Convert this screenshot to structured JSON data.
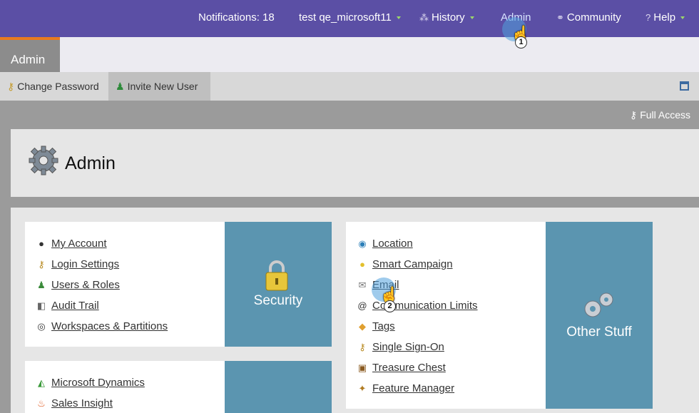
{
  "topnav": {
    "notifications": "Notifications: 18",
    "user": "test qe_microsoft11",
    "history": "History",
    "admin": "Admin",
    "community": "Community",
    "help": "Help"
  },
  "tabs": {
    "admin": "Admin"
  },
  "toolbar": {
    "change_password": "Change Password",
    "invite_user": "Invite New User"
  },
  "access": "Full Access",
  "header": {
    "title": "Admin"
  },
  "security": {
    "tile_label": "Security",
    "items": [
      {
        "label": "My Account",
        "icon": "person-icon"
      },
      {
        "label": "Login Settings",
        "icon": "key-icon"
      },
      {
        "label": "Users & Roles",
        "icon": "users-icon"
      },
      {
        "label": "Audit Trail",
        "icon": "camera-icon"
      },
      {
        "label": "Workspaces & Partitions",
        "icon": "globe-icon"
      }
    ]
  },
  "other": {
    "tile_label": "Other Stuff",
    "items": [
      {
        "label": "Location",
        "icon": "globe-pin-icon"
      },
      {
        "label": "Smart Campaign",
        "icon": "lightbulb-icon"
      },
      {
        "label": "Email",
        "icon": "envelope-icon"
      },
      {
        "label": "Communication Limits",
        "icon": "at-icon"
      },
      {
        "label": "Tags",
        "icon": "tag-icon"
      },
      {
        "label": "Single Sign-On",
        "icon": "key-icon"
      },
      {
        "label": "Treasure Chest",
        "icon": "chest-icon"
      },
      {
        "label": "Feature Manager",
        "icon": "wand-icon"
      }
    ]
  },
  "integration": {
    "items": [
      {
        "label": "Microsoft Dynamics",
        "icon": "dynamics-icon"
      },
      {
        "label": "Sales Insight",
        "icon": "flame-icon"
      }
    ]
  },
  "callouts": {
    "first": "1",
    "second": "2"
  }
}
